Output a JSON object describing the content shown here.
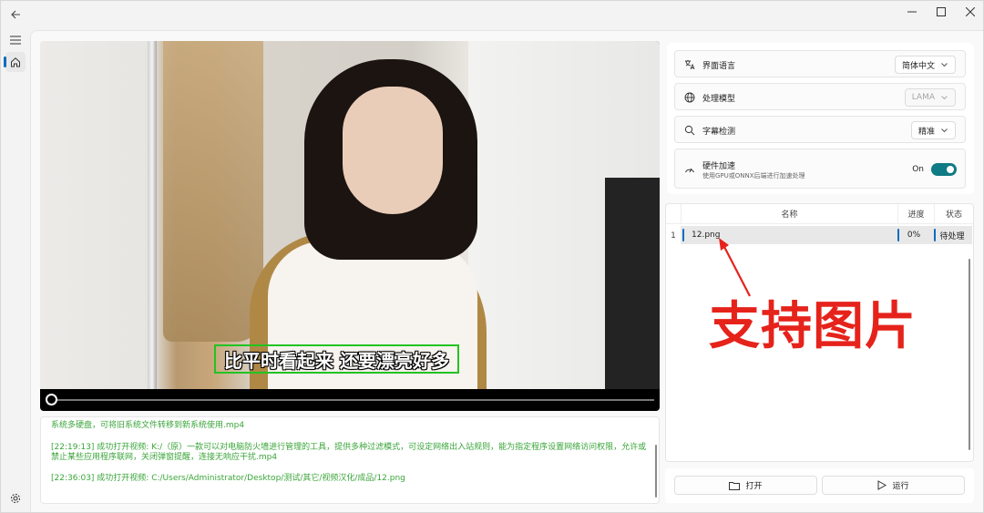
{
  "window": {
    "controls": [
      "minimize",
      "maximize",
      "close"
    ]
  },
  "rail": {
    "items": [
      {
        "icon": "hamburger-menu-icon"
      },
      {
        "icon": "home-icon",
        "active": true
      },
      {
        "icon": "settings-gear-icon"
      }
    ]
  },
  "video": {
    "subtitle": "比平时看起来 还要漂亮好多",
    "progress": 0
  },
  "log": {
    "lines": [
      "系统多硬盘，可将旧系统文件转移到新系统使用.mp4",
      "[22:19:13] 成功打开视频: K:/（原）一款可以对电脑防火墙进行管理的工具，提供多种过滤模式，可设定网络出入站规则，能为指定程序设置网络访问权限，允许或禁止某些应用程序联网，关闭弹窗提醒，连接无响应干扰.mp4",
      "[22:36:03] 成功打开视频: C:/Users/Administrator/Desktop/测试/其它/视频汉化/成品/12.png"
    ]
  },
  "settings": {
    "language": {
      "label": "界面语言",
      "value": "简体中文"
    },
    "model": {
      "label": "处理模型",
      "value": "LAMA"
    },
    "subtitle_detect": {
      "label": "字幕检测",
      "value": "精准"
    },
    "hw_accel": {
      "label": "硬件加速",
      "sublabel": "使用GPU或ONNX后端进行加速处理",
      "state": "On"
    }
  },
  "table": {
    "headers": {
      "name": "名称",
      "progress": "进度",
      "status": "状态"
    },
    "rows": [
      {
        "index": "1",
        "name": "12.png",
        "progress": "0%",
        "status": "待处理"
      }
    ]
  },
  "annotation": {
    "text": "支持图片",
    "color": "#e5231b"
  },
  "actions": {
    "open": "打开",
    "run": "运行"
  },
  "colors": {
    "accent": "#0f6cbd",
    "toggle": "#0f7b84",
    "log_text": "#3aa53a",
    "subtitle_box": "#22c322"
  }
}
